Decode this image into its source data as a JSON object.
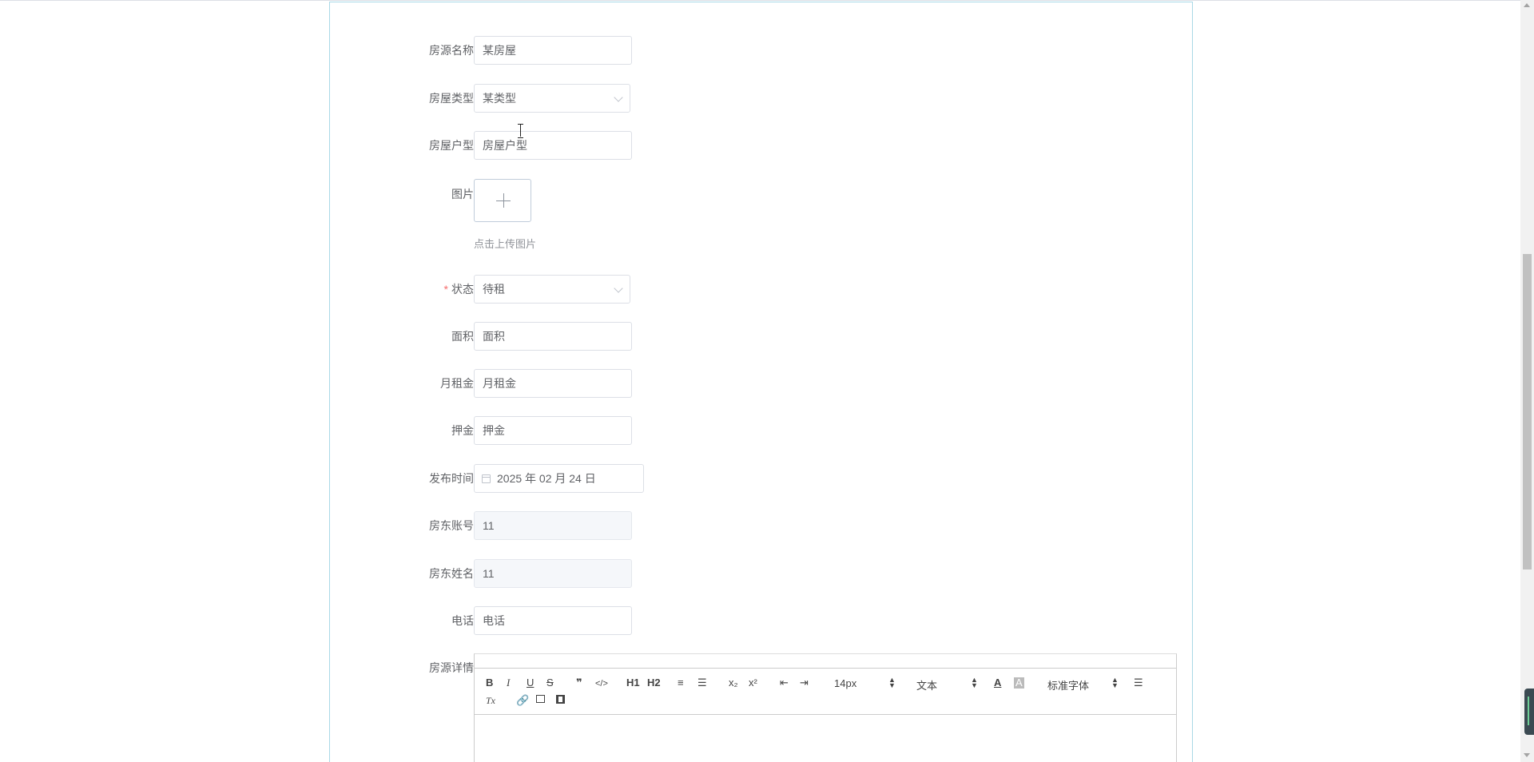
{
  "form": {
    "fields": {
      "name": {
        "label": "房源名称",
        "value": "某房屋"
      },
      "type": {
        "label": "房屋类型",
        "value": "某类型"
      },
      "layout": {
        "label": "房屋户型",
        "value": "房屋户型"
      },
      "image": {
        "label": "图片",
        "tip": "点击上传图片"
      },
      "status": {
        "required_mark": "*",
        "label": "状态",
        "value": "待租"
      },
      "area": {
        "label": "面积",
        "placeholder": "面积"
      },
      "rent": {
        "label": "月租金",
        "placeholder": "月租金"
      },
      "deposit": {
        "label": "押金",
        "placeholder": "押金"
      },
      "publish_time": {
        "label": "发布时间",
        "value": "2025 年 02 月 24 日"
      },
      "landlord_account": {
        "label": "房东账号",
        "value": "11"
      },
      "landlord_name": {
        "label": "房东姓名",
        "value": "11"
      },
      "phone": {
        "label": "电话",
        "placeholder": "电话"
      },
      "details": {
        "label": "房源详情"
      }
    },
    "editor_toolbar": {
      "bold": "B",
      "italic": "I",
      "underline": "U",
      "strike": "S",
      "blockquote": "❞",
      "code": "</>",
      "h1": "H1",
      "h2": "H2",
      "ordered_list": "≡",
      "bullet_list": "☰",
      "subscript": "x₂",
      "superscript": "x²",
      "outdent": "⇤",
      "indent": "⇥",
      "size_select": "14px",
      "header_select": "文本",
      "font_select": "标准字体",
      "clean": "Tx"
    }
  },
  "icons": {
    "select_arrow": "chevron-down-icon",
    "date_icon": "calendar-icon",
    "upload_icon": "plus-icon"
  },
  "colors": {
    "card_border": "#a9d8e6",
    "required": "#f56c6c",
    "text": "#606266",
    "disabled_bg": "#f5f7fa"
  }
}
